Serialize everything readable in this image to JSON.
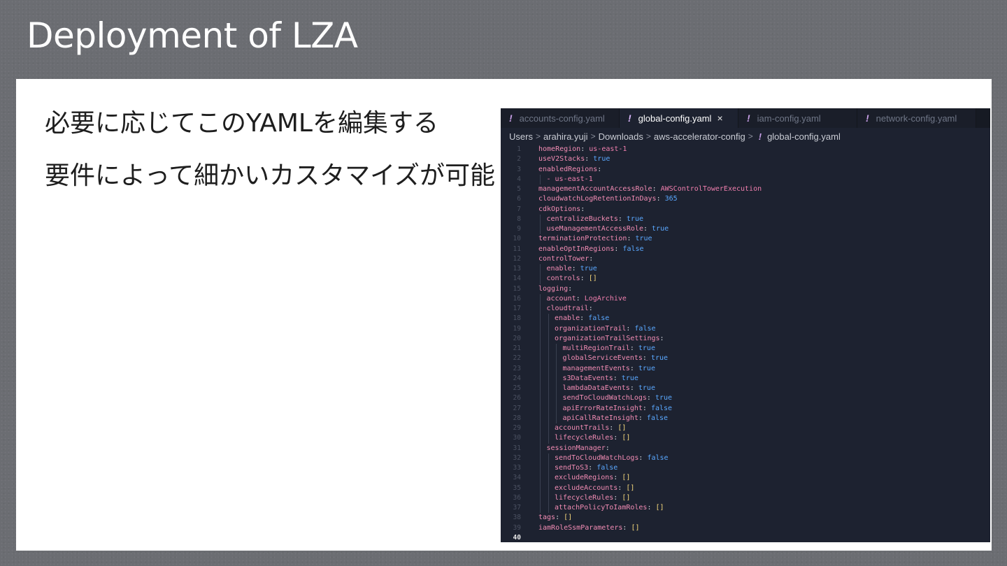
{
  "slide": {
    "title": "Deployment of LZA",
    "bullets": [
      "必要に応じてこのYAMLを編集する",
      "要件によって細かいカスタマイズが可能"
    ]
  },
  "editor": {
    "tabs": [
      {
        "label": "accounts-config.yaml",
        "active": false
      },
      {
        "label": "global-config.yaml",
        "active": true,
        "close": "×"
      },
      {
        "label": "iam-config.yaml",
        "active": false
      },
      {
        "label": "network-config.yaml",
        "active": false
      }
    ],
    "tab_icon": "!",
    "breadcrumb": [
      "Users",
      "arahira.yuji",
      "Downloads",
      "aws-accelerator-config",
      "global-config.yaml"
    ],
    "breadcrumb_sep": ">",
    "current_line": 40,
    "lines": [
      {
        "n": 1,
        "i": 0,
        "key": "homeRegion",
        "val": "us-east-1",
        "t": "s"
      },
      {
        "n": 2,
        "i": 0,
        "key": "useV2Stacks",
        "val": "true",
        "t": "b"
      },
      {
        "n": 3,
        "i": 0,
        "key": "enabledRegions",
        "val": "",
        "t": ""
      },
      {
        "n": 4,
        "i": 1,
        "item": "- us-east-1"
      },
      {
        "n": 5,
        "i": 0,
        "key": "managementAccountAccessRole",
        "val": "AWSControlTowerExecution",
        "t": "s"
      },
      {
        "n": 6,
        "i": 0,
        "key": "cloudwatchLogRetentionInDays",
        "val": "365",
        "t": "n"
      },
      {
        "n": 7,
        "i": 0,
        "key": "cdkOptions",
        "val": "",
        "t": ""
      },
      {
        "n": 8,
        "i": 1,
        "key": "centralizeBuckets",
        "val": "true",
        "t": "b"
      },
      {
        "n": 9,
        "i": 1,
        "key": "useManagementAccessRole",
        "val": "true",
        "t": "b"
      },
      {
        "n": 10,
        "i": 0,
        "key": "terminationProtection",
        "val": "true",
        "t": "b"
      },
      {
        "n": 11,
        "i": 0,
        "key": "enableOptInRegions",
        "val": "false",
        "t": "b"
      },
      {
        "n": 12,
        "i": 0,
        "key": "controlTower",
        "val": "",
        "t": ""
      },
      {
        "n": 13,
        "i": 1,
        "key": "enable",
        "val": "true",
        "t": "b"
      },
      {
        "n": 14,
        "i": 1,
        "key": "controls",
        "val": "[]",
        "t": "br"
      },
      {
        "n": 15,
        "i": 0,
        "key": "logging",
        "val": "",
        "t": ""
      },
      {
        "n": 16,
        "i": 1,
        "key": "account",
        "val": "LogArchive",
        "t": "s"
      },
      {
        "n": 17,
        "i": 1,
        "key": "cloudtrail",
        "val": "",
        "t": ""
      },
      {
        "n": 18,
        "i": 2,
        "key": "enable",
        "val": "false",
        "t": "b"
      },
      {
        "n": 19,
        "i": 2,
        "key": "organizationTrail",
        "val": "false",
        "t": "b"
      },
      {
        "n": 20,
        "i": 2,
        "key": "organizationTrailSettings",
        "val": "",
        "t": ""
      },
      {
        "n": 21,
        "i": 3,
        "key": "multiRegionTrail",
        "val": "true",
        "t": "b"
      },
      {
        "n": 22,
        "i": 3,
        "key": "globalServiceEvents",
        "val": "true",
        "t": "b"
      },
      {
        "n": 23,
        "i": 3,
        "key": "managementEvents",
        "val": "true",
        "t": "b"
      },
      {
        "n": 24,
        "i": 3,
        "key": "s3DataEvents",
        "val": "true",
        "t": "b"
      },
      {
        "n": 25,
        "i": 3,
        "key": "lambdaDataEvents",
        "val": "true",
        "t": "b"
      },
      {
        "n": 26,
        "i": 3,
        "key": "sendToCloudWatchLogs",
        "val": "true",
        "t": "b"
      },
      {
        "n": 27,
        "i": 3,
        "key": "apiErrorRateInsight",
        "val": "false",
        "t": "b"
      },
      {
        "n": 28,
        "i": 3,
        "key": "apiCallRateInsight",
        "val": "false",
        "t": "b"
      },
      {
        "n": 29,
        "i": 2,
        "key": "accountTrails",
        "val": "[]",
        "t": "br"
      },
      {
        "n": 30,
        "i": 2,
        "key": "lifecycleRules",
        "val": "[]",
        "t": "br"
      },
      {
        "n": 31,
        "i": 1,
        "key": "sessionManager",
        "val": "",
        "t": ""
      },
      {
        "n": 32,
        "i": 2,
        "key": "sendToCloudWatchLogs",
        "val": "false",
        "t": "b"
      },
      {
        "n": 33,
        "i": 2,
        "key": "sendToS3",
        "val": "false",
        "t": "b"
      },
      {
        "n": 34,
        "i": 2,
        "key": "excludeRegions",
        "val": "[]",
        "t": "br"
      },
      {
        "n": 35,
        "i": 2,
        "key": "excludeAccounts",
        "val": "[]",
        "t": "br"
      },
      {
        "n": 36,
        "i": 2,
        "key": "lifecycleRules",
        "val": "[]",
        "t": "br"
      },
      {
        "n": 37,
        "i": 2,
        "key": "attachPolicyToIamRoles",
        "val": "[]",
        "t": "br"
      },
      {
        "n": 38,
        "i": 0,
        "key": "tags",
        "val": "[]",
        "t": "br"
      },
      {
        "n": 39,
        "i": 0,
        "key": "iamRoleSsmParameters",
        "val": "[]",
        "t": "br"
      },
      {
        "n": 40,
        "i": 0
      }
    ]
  }
}
